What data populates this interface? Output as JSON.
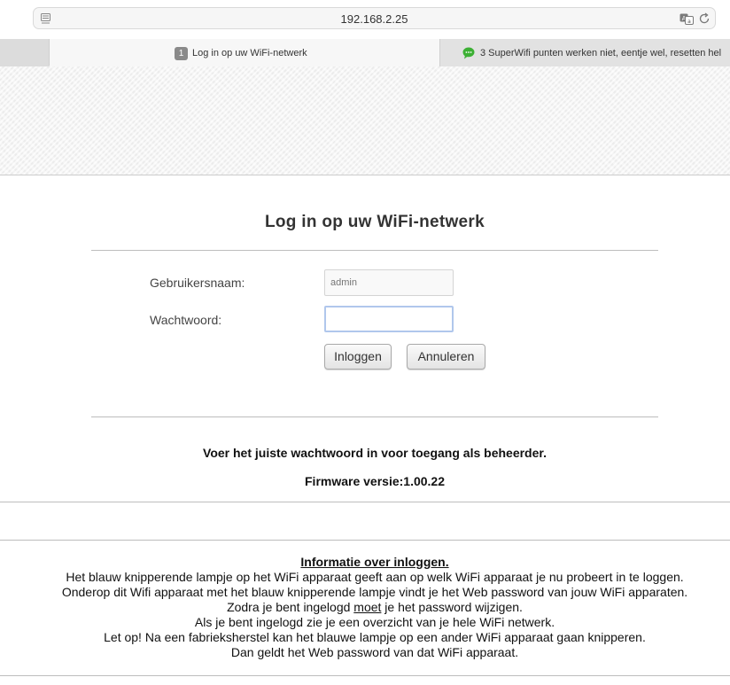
{
  "browser": {
    "url": "192.168.2.25",
    "tabs": [
      {
        "number": "1",
        "title": "Log in op uw WiFi-netwerk"
      },
      {
        "title": "3 SuperWifi punten werken niet, eentje wel, resetten hel"
      }
    ]
  },
  "login": {
    "title": "Log in op uw WiFi-netwerk",
    "username_label": "Gebruikersnaam:",
    "username_placeholder": "admin",
    "password_label": "Wachtwoord:",
    "password_value": "",
    "login_button": "Inloggen",
    "cancel_button": "Annuleren"
  },
  "messages": {
    "hint": "Voer het juiste wachtwoord in voor toegang als beheerder.",
    "firmware": "Firmware versie:1.00.22"
  },
  "info": {
    "title": "Informatie over inloggen.",
    "line1": "Het blauw knipperende lampje op het WiFi apparaat geeft aan op welk WiFi apparaat je nu probeert in te loggen.",
    "line2": "Onderop dit Wifi apparaat met het blauw knipperende lampje vindt je het Web password van jouw WiFi apparaten.",
    "line3_pre": "Zodra je bent ingelogd ",
    "line3_em": "moet",
    "line3_post": " je het password wijzigen.",
    "line4": "Als je bent ingelogd zie je een overzicht van je hele WiFi netwerk.",
    "line5": "Let op! Na een fabrieksherstel kan het blauwe lampje op een ander WiFi apparaat gaan knipperen.",
    "line6": "Dan geldt het Web password van dat WiFi apparaat."
  },
  "icons": {
    "page_icon": "page-icon",
    "translate": "translate-icon",
    "reload": "reload-icon",
    "tab_favicon": "green-chat-favicon"
  },
  "colors": {
    "favicon_green": "#3cb034",
    "input_focus": "#b0c7ec"
  }
}
